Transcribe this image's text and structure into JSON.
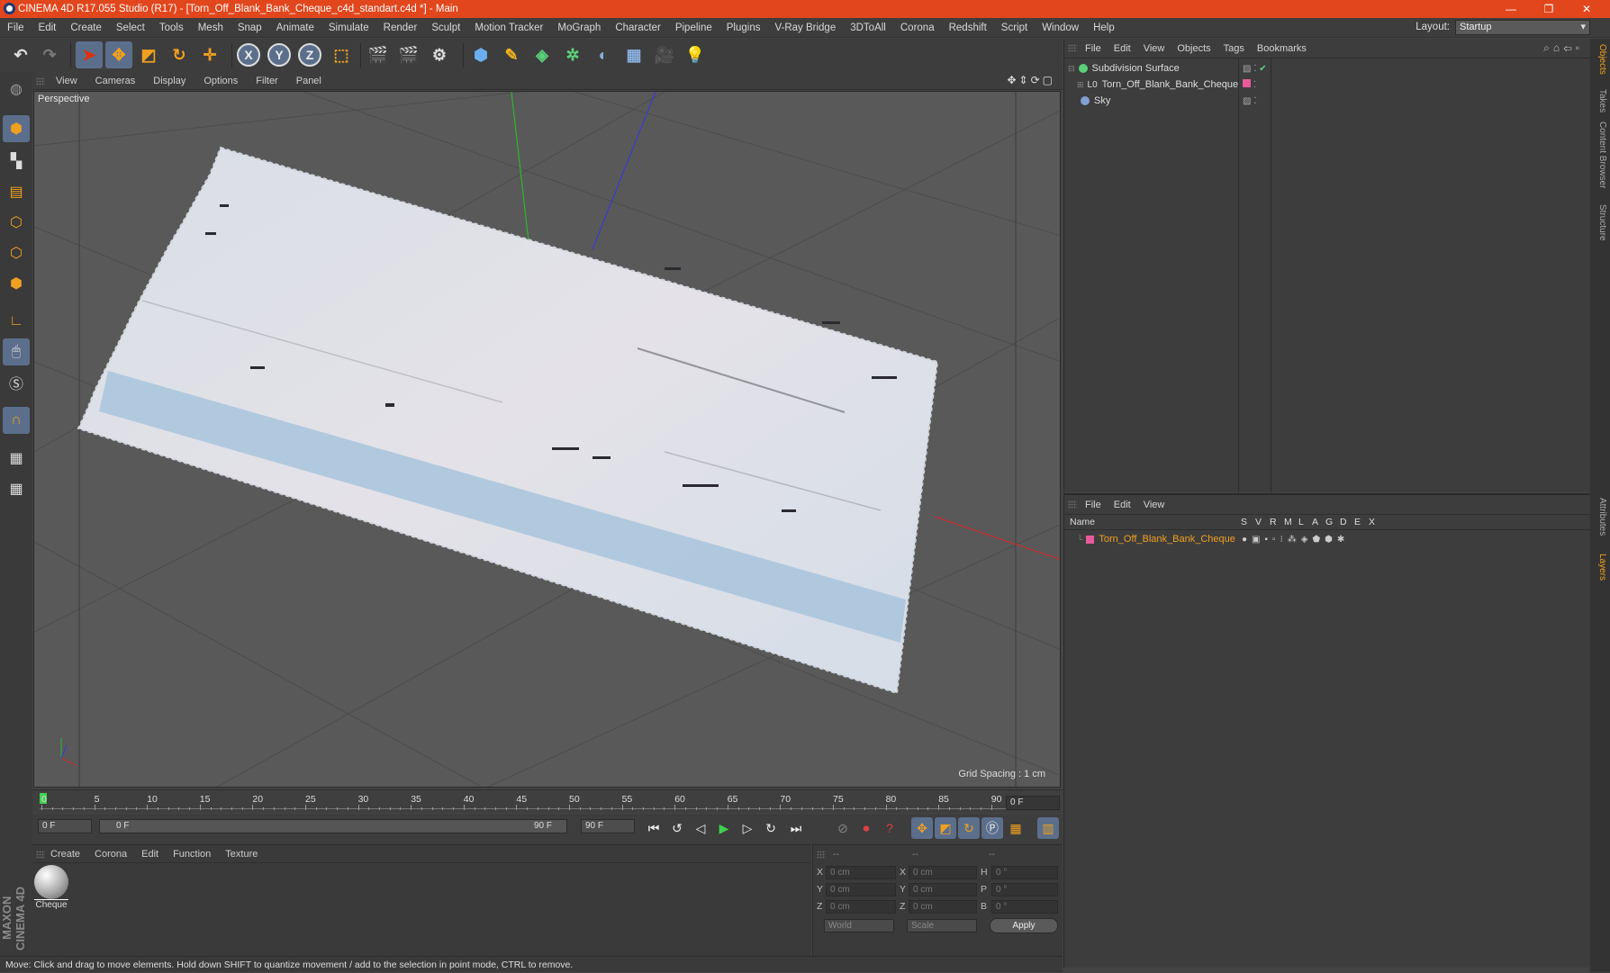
{
  "window": {
    "title": "CINEMA 4D R17.055 Studio (R17) - [Torn_Off_Blank_Bank_Cheque_c4d_standart.c4d *] - Main",
    "minimize": "—",
    "restore": "❐",
    "close": "✕"
  },
  "menubar": {
    "items": [
      "File",
      "Edit",
      "Create",
      "Select",
      "Tools",
      "Mesh",
      "Snap",
      "Animate",
      "Simulate",
      "Render",
      "Sculpt",
      "Motion Tracker",
      "MoGraph",
      "Character",
      "Pipeline",
      "Plugins",
      "V-Ray Bridge",
      "3DToAll",
      "Corona",
      "Redshift",
      "Script",
      "Window",
      "Help"
    ],
    "layout_label": "Layout:",
    "layout_value": "Startup"
  },
  "toolbar": {
    "axis_x": "X",
    "axis_y": "Y",
    "axis_z": "Z"
  },
  "viewport": {
    "menu": [
      "View",
      "Cameras",
      "Display",
      "Options",
      "Filter",
      "Panel"
    ],
    "label": "Perspective",
    "grid_spacing": "Grid Spacing : 1 cm"
  },
  "timeline": {
    "ticks": [
      "0",
      "5",
      "10",
      "15",
      "20",
      "25",
      "30",
      "35",
      "40",
      "45",
      "50",
      "55",
      "60",
      "65",
      "70",
      "75",
      "80",
      "85",
      "90"
    ],
    "current_frame": "0 F"
  },
  "transport": {
    "start": "0 F",
    "range_start": "0 F",
    "range_end": "90 F",
    "end": "90 F"
  },
  "materials": {
    "menu": [
      "Create",
      "Corona",
      "Edit",
      "Function",
      "Texture"
    ],
    "items": [
      {
        "name": "Cheque"
      }
    ]
  },
  "attributes": {
    "header": [
      "--",
      "--",
      "--"
    ],
    "rows": [
      {
        "l1": "X",
        "v1": "0 cm",
        "l2": "X",
        "v2": "0 cm",
        "l3": "H",
        "v3": "0 °"
      },
      {
        "l1": "Y",
        "v1": "0 cm",
        "l2": "Y",
        "v2": "0 cm",
        "l3": "P",
        "v3": "0 °"
      },
      {
        "l1": "Z",
        "v1": "0 cm",
        "l2": "Z",
        "v2": "0 cm",
        "l3": "B",
        "v3": "0 °"
      }
    ],
    "world": "World",
    "scale": "Scale",
    "apply": "Apply"
  },
  "status": "Move: Click and drag to move elements. Hold down SHIFT to quantize movement / add to the selection in point mode, CTRL to remove.",
  "object_manager": {
    "menu": [
      "File",
      "Edit",
      "View",
      "Objects",
      "Tags",
      "Bookmarks"
    ],
    "objects": [
      {
        "name": "Subdivision Surface",
        "color": "#5cd07a"
      },
      {
        "name": "Torn_Off_Blank_Bank_Cheque",
        "color": "#e8e8e8"
      },
      {
        "name": "Sky",
        "color": "#7fa0d0"
      }
    ]
  },
  "layer_manager": {
    "menu": [
      "File",
      "Edit",
      "View"
    ],
    "columns": [
      "Name",
      "S",
      "V",
      "R",
      "M",
      "L",
      "A",
      "G",
      "D",
      "E",
      "X"
    ],
    "layers": [
      {
        "name": "Torn_Off_Blank_Bank_Cheque",
        "color": "#e85a9a"
      }
    ]
  },
  "right_tabs": [
    "Objects",
    "Takes",
    "Content Browser",
    "Structure",
    "Attributes",
    "Layers"
  ],
  "brand": "MAXON CINEMA 4D",
  "colors": {
    "title": "#e2461c",
    "accent": "#f0a020",
    "selected": "#5b6f8c"
  }
}
